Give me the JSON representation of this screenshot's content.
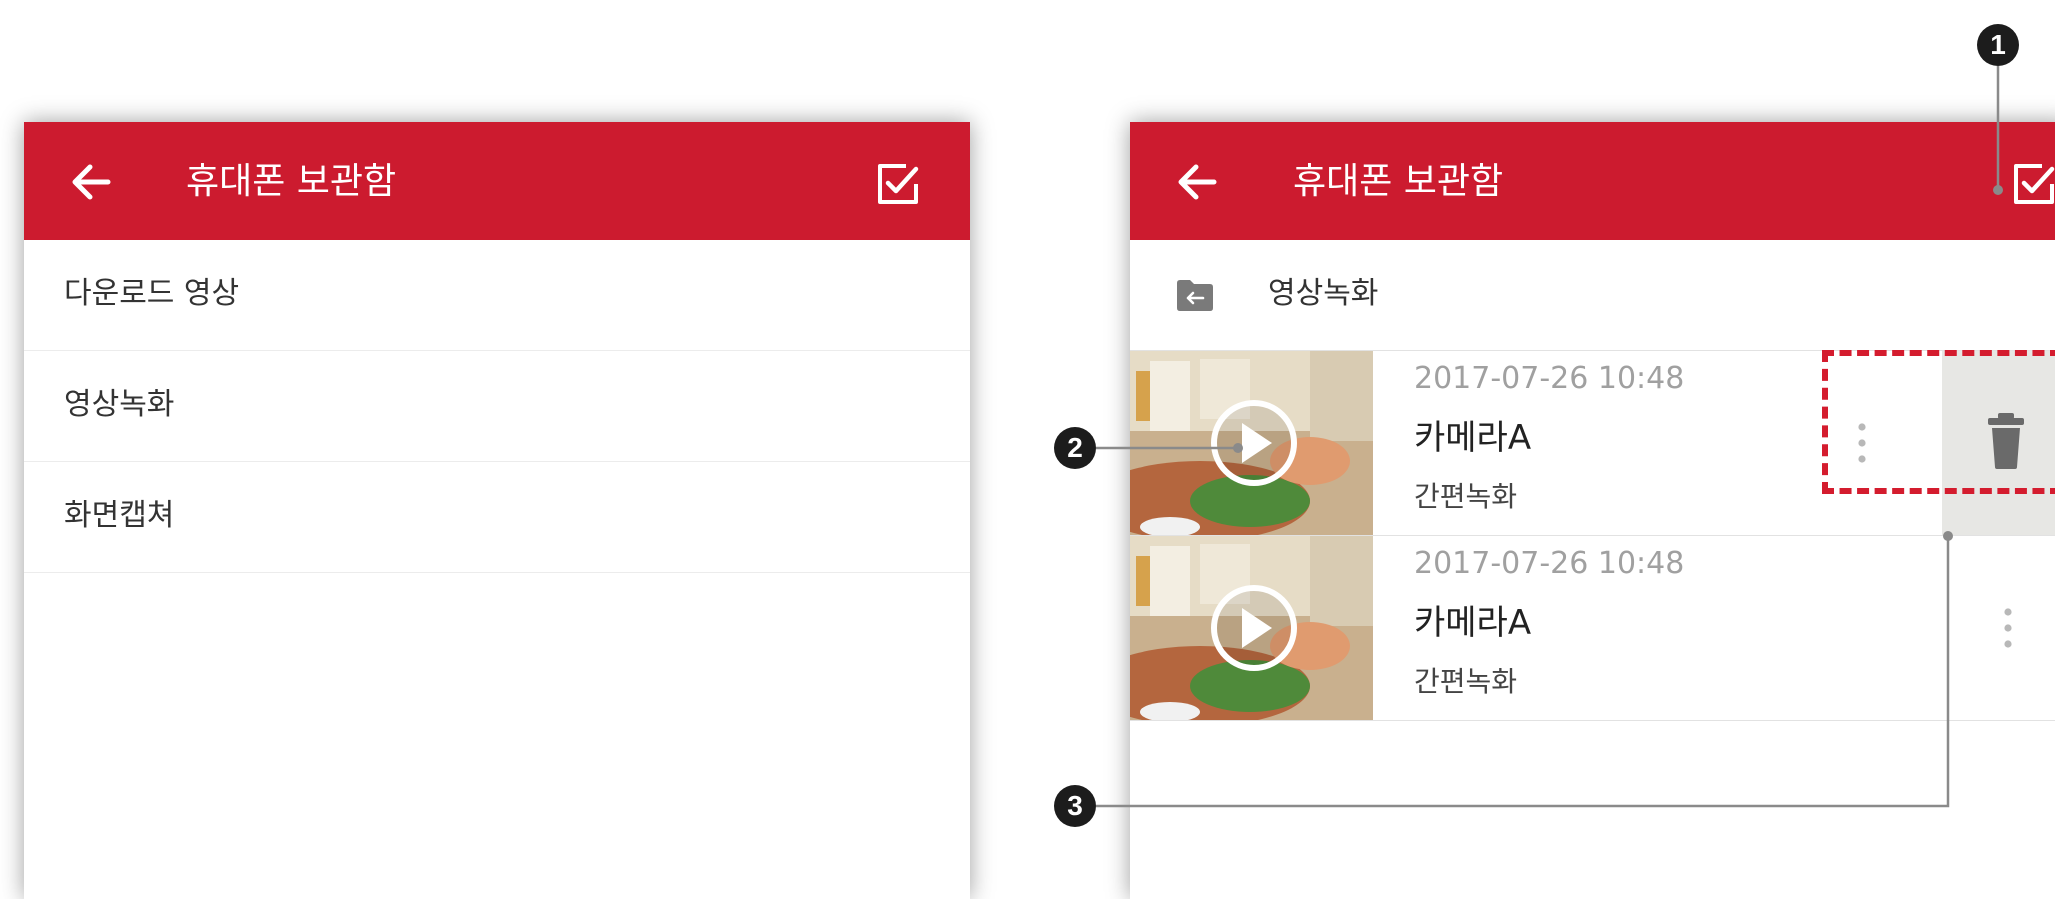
{
  "left_screen": {
    "title": "휴대폰 보관함",
    "back_icon": "arrow-left-icon",
    "edit_icon": "checkbox-edit-icon",
    "menu_items": [
      {
        "label": "다운로드 영상"
      },
      {
        "label": "영상녹화"
      },
      {
        "label": "화면캡쳐"
      }
    ]
  },
  "right_screen": {
    "title": "휴대폰 보관함",
    "back_icon": "arrow-left-icon",
    "edit_icon": "checkbox-edit-icon",
    "folder": {
      "label": "영상녹화",
      "icon": "folder-back-icon"
    },
    "videos": [
      {
        "date": "2017-07-26 10:48",
        "camera": "카메라A",
        "type": "간편녹화",
        "delete_revealed": true
      },
      {
        "date": "2017-07-26 10:48",
        "camera": "카메라A",
        "type": "간편녹화",
        "delete_revealed": false
      }
    ],
    "delete_icon": "trash-icon",
    "more_icon": "more-vertical-icon"
  },
  "callouts": [
    {
      "number": "1"
    },
    {
      "number": "2"
    },
    {
      "number": "3"
    }
  ],
  "colors": {
    "appbar": "#cc1b2f",
    "highlight": "#d41c2e",
    "callout": "#1c1c1c",
    "delete_panel": "#e7e7e4"
  }
}
